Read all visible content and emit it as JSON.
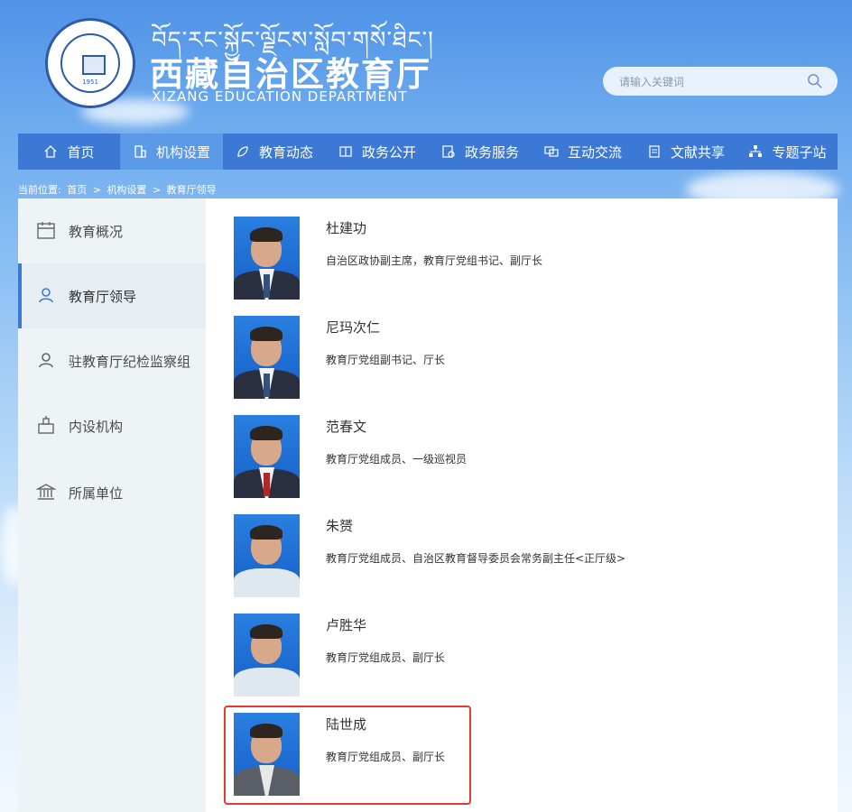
{
  "header": {
    "tibetan_title": "བོད་རང་སྐྱོང་ལྗོངས་སློབ་གསོ་ཐིང་།",
    "title": "西藏自治区教育厅",
    "subtitle": "XIZANG EDUCATION DEPARTMENT",
    "logo_year": "1951"
  },
  "search": {
    "placeholder": "请输入关键词",
    "icon": "search-icon"
  },
  "nav": {
    "items": [
      {
        "label": "首页",
        "icon": "home-icon"
      },
      {
        "label": "机构设置",
        "icon": "building-icon",
        "active": true
      },
      {
        "label": "教育动态",
        "icon": "leaf-icon"
      },
      {
        "label": "政务公开",
        "icon": "book-icon"
      },
      {
        "label": "政务服务",
        "icon": "service-icon"
      },
      {
        "label": "互动交流",
        "icon": "chat-icon"
      },
      {
        "label": "文献共享",
        "icon": "document-icon"
      },
      {
        "label": "专题子站",
        "icon": "sitemap-icon"
      }
    ]
  },
  "breadcrumb": {
    "prefix": "当前位置:",
    "items": [
      "首页",
      ">",
      "机构设置",
      ">",
      "教育厅领导"
    ]
  },
  "sidebar": {
    "items": [
      {
        "label": "教育概况",
        "icon": "calendar-icon"
      },
      {
        "label": "教育厅领导",
        "icon": "user-icon",
        "active": true
      },
      {
        "label": "驻教育厅纪检监察组",
        "icon": "user-icon"
      },
      {
        "label": "内设机构",
        "icon": "organization-icon"
      },
      {
        "label": "所属单位",
        "icon": "institution-icon"
      }
    ]
  },
  "leaders": [
    {
      "name": "杜建功",
      "title": "自治区政协副主席，教育厅党组书记、副厅长"
    },
    {
      "name": "尼玛次仁",
      "title": "教育厅党组副书记、厅长"
    },
    {
      "name": "范春文",
      "title": "教育厅党组成员、一级巡视员"
    },
    {
      "name": "朱赟",
      "title": "教育厅党组成员、自治区教育督导委员会常务副主任<正厅级>"
    },
    {
      "name": "卢胜华",
      "title": "教育厅党组成员、副厅长"
    },
    {
      "name": "陆世成",
      "title": "教育厅党组成员、副厅长"
    }
  ],
  "colors": {
    "nav_bg": "#3b79d4",
    "nav_active": "#5a9ae6",
    "highlight": "#e03a3a"
  }
}
